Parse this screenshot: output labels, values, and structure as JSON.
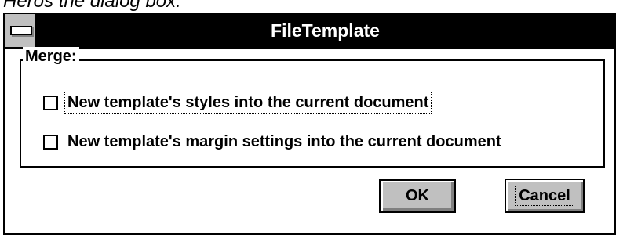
{
  "context_text": "Heros the dialog box.",
  "dialog": {
    "title": "FileTemplate",
    "group": {
      "label": "Merge:",
      "options": [
        {
          "label": "New template's styles into the current document",
          "checked": false,
          "focused": true
        },
        {
          "label": "New template's margin settings into the current document",
          "checked": false,
          "focused": false
        }
      ]
    },
    "buttons": {
      "ok": "OK",
      "cancel": "Cancel"
    }
  }
}
